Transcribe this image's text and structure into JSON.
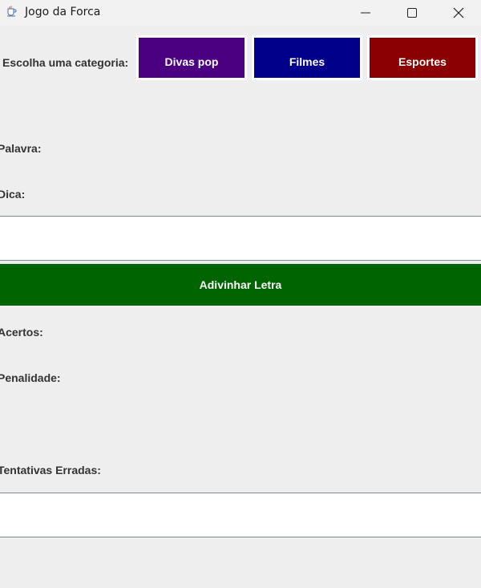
{
  "window": {
    "title": "Jogo da Forca"
  },
  "category_label": "Escolha uma categoria:",
  "categories": [
    {
      "label": "Divas pop",
      "color": "#4b0082"
    },
    {
      "label": "Filmes",
      "color": "#00008b"
    },
    {
      "label": "Esportes",
      "color": "#8b0000"
    }
  ],
  "labels": {
    "palavra": "Palavra:",
    "dica": "Dica:",
    "acertos": "Acertos:",
    "penalidade": "Penalidade:",
    "tentativas": "Tentativas Erradas:"
  },
  "guess_button": {
    "label": "Adivinhar Letra",
    "color": "#006400"
  },
  "inputs": {
    "letter_value": "",
    "wrong_attempts_value": ""
  },
  "icons": {
    "app": "java-cup-icon",
    "minimize": "minimize-icon",
    "maximize": "maximize-icon",
    "close": "close-icon"
  }
}
